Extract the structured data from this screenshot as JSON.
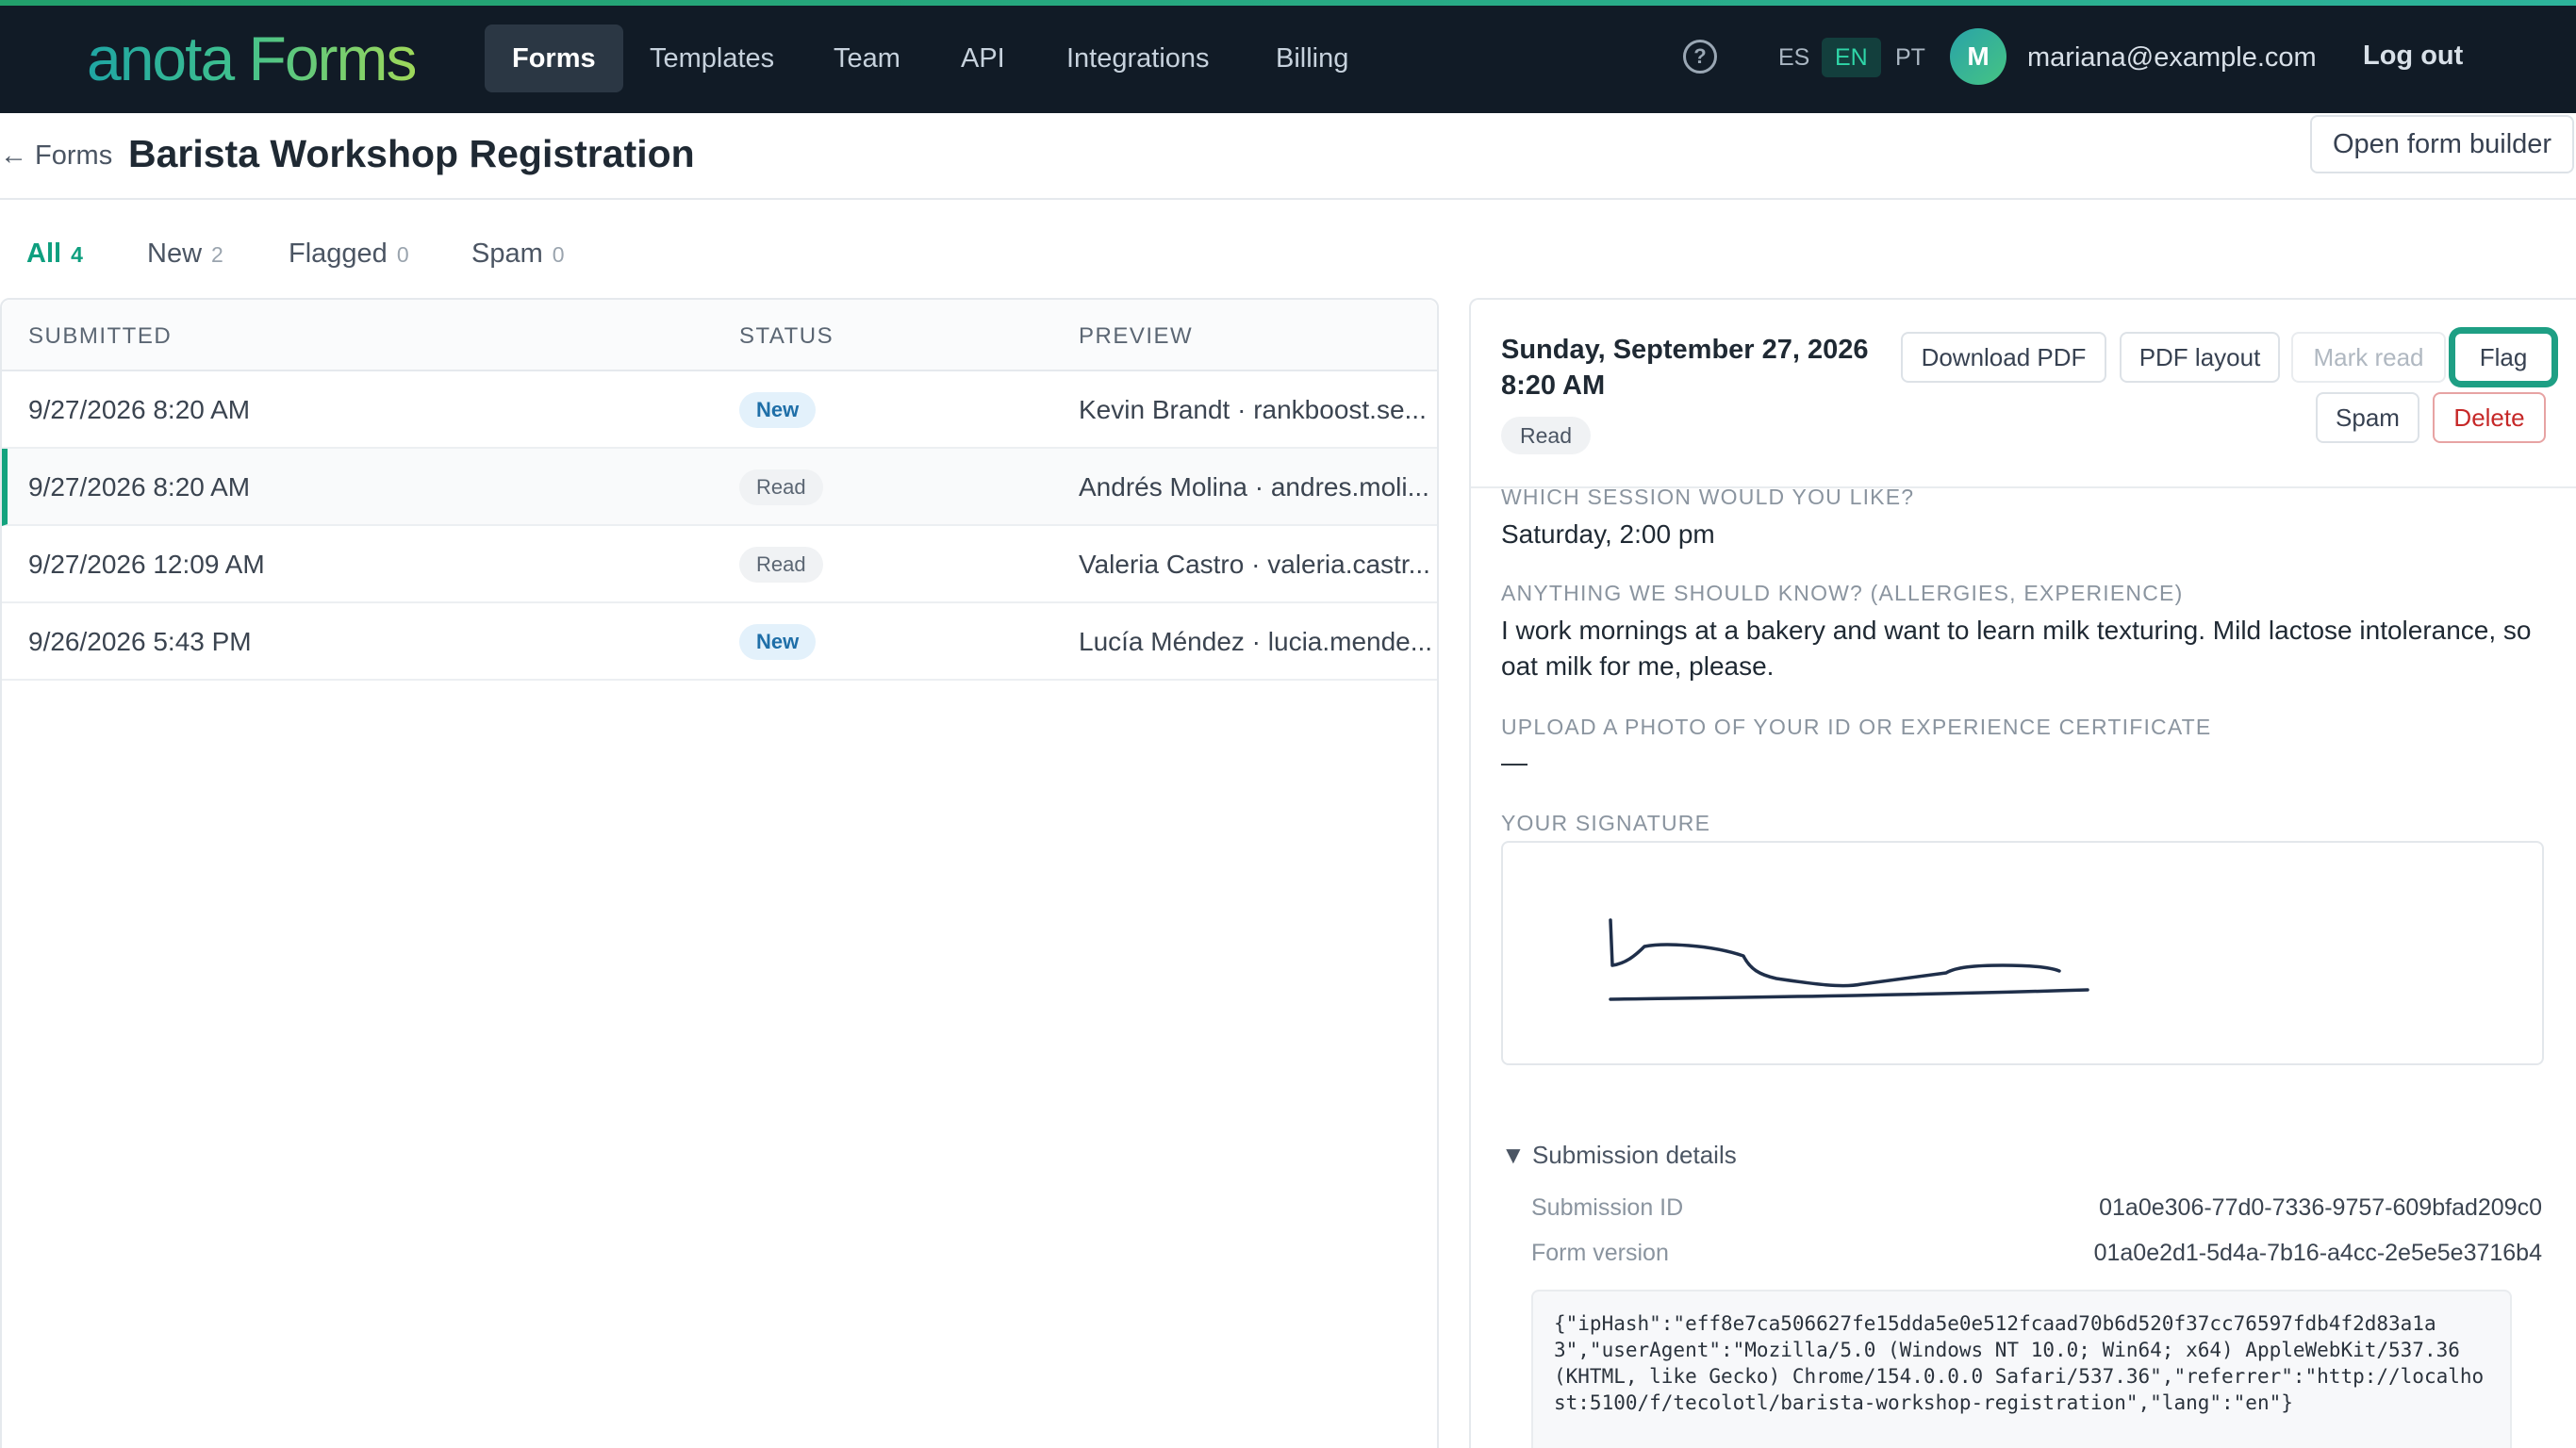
{
  "app": {
    "brand": "anota Forms",
    "nav": [
      "Forms",
      "Templates",
      "Team",
      "API",
      "Integrations",
      "Billing"
    ],
    "help_glyph": "?",
    "languages": [
      "ES",
      "EN",
      "PT"
    ],
    "active_language": "EN",
    "user": {
      "initial": "M",
      "email": "mariana@example.com"
    },
    "logout_label": "Log out",
    "accent_color": "#13a37e"
  },
  "page": {
    "back_label": "← Forms",
    "title": "Barista Workshop Registration",
    "open_builder_label": "Open form builder"
  },
  "filters": [
    {
      "label": "All",
      "count": "4"
    },
    {
      "label": "New",
      "count": "2"
    },
    {
      "label": "Flagged",
      "count": "0"
    },
    {
      "label": "Spam",
      "count": "0"
    }
  ],
  "table": {
    "columns": [
      "SUBMITTED",
      "STATUS",
      "PREVIEW"
    ],
    "rows": [
      {
        "submitted": "9/27/2026 8:20 AM",
        "status": "New",
        "preview": "Kevin Brandt · rankboost.se..."
      },
      {
        "submitted": "9/27/2026 8:20 AM",
        "status": "Read",
        "preview": "Andrés Molina · andres.moli..."
      },
      {
        "submitted": "9/27/2026 12:09 AM",
        "status": "Read",
        "preview": "Valeria Castro · valeria.castr..."
      },
      {
        "submitted": "9/26/2026 5:43 PM",
        "status": "New",
        "preview": "Lucía Méndez · lucia.mende..."
      }
    ]
  },
  "detail": {
    "date_line1": "Sunday, September 27, 2026",
    "date_line2": "8:20 AM",
    "status": "Read",
    "actions": {
      "download_pdf": "Download PDF",
      "pdf_layout": "PDF layout",
      "mark_read": "Mark read",
      "flag": "Flag",
      "spam": "Spam",
      "delete": "Delete"
    },
    "fields": [
      {
        "label": "WHICH SESSION WOULD YOU LIKE?",
        "value": "Saturday, 2:00 pm"
      },
      {
        "label": "ANYTHING WE SHOULD KNOW? (ALLERGIES, EXPERIENCE)",
        "value": "I work mornings at a bakery and want to learn milk texturing. Mild lactose intolerance, so oat milk for me, please."
      },
      {
        "label": "UPLOAD A PHOTO OF YOUR ID OR EXPERIENCE CERTIFICATE",
        "value": "—"
      },
      {
        "label": "YOUR SIGNATURE",
        "value": ""
      }
    ],
    "submission_details": {
      "summary": "▼ Submission details",
      "submission_id_label": "Submission ID",
      "submission_id": "01a0e306-77d0-7336-9757-609bfad209c0",
      "form_version_label": "Form version",
      "form_version": "01a0e2d1-5d4a-7b16-a4cc-2e5e5e3716b4",
      "meta": "{\"ipHash\":\"eff8e7ca506627fe15dda5e0e512fcaad70b6d520f37cc76597fdb4f2d83a1a3\",\"userAgent\":\"Mozilla/5.0 (Windows NT 10.0; Win64; x64) AppleWebKit/537.36 (KHTML, like Gecko) Chrome/154.0.0.0 Safari/537.36\",\"referrer\":\"http://localhost:5100/f/tecolotl/barista-workshop-registration\",\"lang\":\"en\"}"
    }
  }
}
